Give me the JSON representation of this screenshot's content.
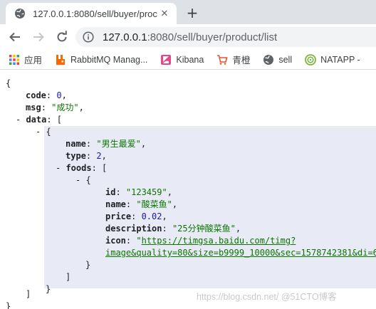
{
  "browser": {
    "tab": {
      "title": "127.0.0.1:8080/sell/buyer/proc"
    },
    "address": {
      "host": "127.0.0.1",
      "path": ":8080/sell/buyer/product/list"
    },
    "bookmarks": [
      {
        "label": "应用",
        "icon": "apps-grid-icon"
      },
      {
        "label": "RabbitMQ Manag...",
        "icon": "rabbitmq-icon"
      },
      {
        "label": "Kibana",
        "icon": "kibana-icon"
      },
      {
        "label": "青橙",
        "icon": "qingcheng-cart-icon"
      },
      {
        "label": "sell",
        "icon": "globe-icon"
      },
      {
        "label": "NATAPP -",
        "icon": "natapp-icon"
      }
    ]
  },
  "json": {
    "open_brace": "{",
    "close_brace": "}",
    "code_key": "code",
    "code_value": "0",
    "msg_key": "msg",
    "msg_value": "\"成功\"",
    "data_key": "data",
    "name_key": "name",
    "name_value": "\"男生最爱\"",
    "type_key": "type",
    "type_value": "2",
    "foods_key": "foods",
    "id_key": "id",
    "id_value": "\"123459\"",
    "food_name_value": "\"酸菜鱼\"",
    "price_key": "price",
    "price_value": "0.02",
    "description_key": "description",
    "description_value": "\"25分钟酸菜鱼\"",
    "icon_key": "icon",
    "icon_value_line1": "https://timgsa.baidu.com/timg?",
    "icon_value_line2": "image&quality=80&size=b9999_10000&sec=1578742381&di=6d"
  },
  "watermark": "https://blog.csdn.net/  @51CTO博客",
  "colors": {
    "string": "#0b7500",
    "number": "#1a1aa6",
    "highlight": "#e8eaf6",
    "tab_strip": "#dee1e6"
  }
}
